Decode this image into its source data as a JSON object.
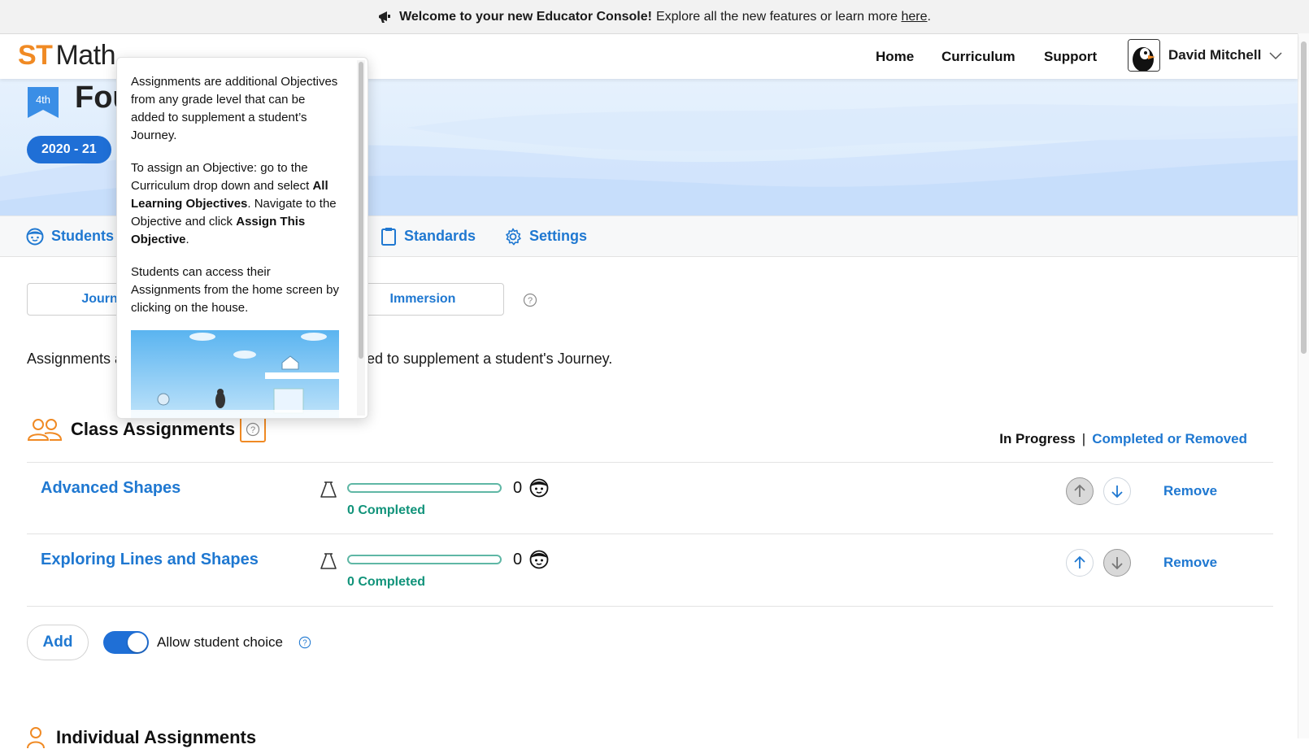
{
  "banner": {
    "bold_text": "Welcome to your new Educator Console!",
    "text": "Explore all the new features or learn more",
    "link": "here",
    "period": "."
  },
  "header": {
    "logo_st": "ST",
    "logo_math": "Math",
    "nav": [
      "Home",
      "Curriculum",
      "Support"
    ],
    "user_name": "David Mitchell"
  },
  "hero": {
    "grade_badge": "4th",
    "class_title": "Fou",
    "year": "2020 - 21"
  },
  "tabs": {
    "students": "Students",
    "standards": "Standards",
    "settings": "Settings"
  },
  "segments": {
    "journey": "Journe",
    "immersion": "Immersion"
  },
  "intro": {
    "part_a": "Assignments a",
    "part_b": "ded to supplement a student's Journey."
  },
  "class_assignments": {
    "title": "Class Assignments",
    "filter_active": "In Progress",
    "filter_separator": "|",
    "filter_link": "Completed or Removed",
    "rows": [
      {
        "name": "Advanced Shapes",
        "count": "0",
        "completed": "0 Completed",
        "progress": 0,
        "remove": "Remove",
        "up_disabled": true,
        "down_disabled": false
      },
      {
        "name": "Exploring Lines and Shapes",
        "count": "0",
        "completed": "0 Completed",
        "progress": 0,
        "remove": "Remove",
        "up_disabled": false,
        "down_disabled": true
      }
    ]
  },
  "controls": {
    "add": "Add",
    "allow_choice": "Allow student choice",
    "allow_choice_on": true
  },
  "individual_assignments": {
    "title": "Individual Assignments"
  },
  "popover": {
    "p1": "Assignments are additional Objectives from any grade level that can be added to supplement a student’s Journey.",
    "p2_a": "To assign an Objective: go to the Curriculum drop down and select ",
    "p2_b": "All Learning Objectives",
    "p2_c": ". Navigate to the Objective and click ",
    "p2_d": "Assign This Objective",
    "p2_e": ".",
    "p3": "Students can access their Assignments from the home screen by clicking on the house."
  },
  "colors": {
    "brand_orange": "#f08a24",
    "accent_blue": "#1f78d1",
    "pill_blue": "#1f6fd6",
    "complete_green": "#11937a"
  }
}
